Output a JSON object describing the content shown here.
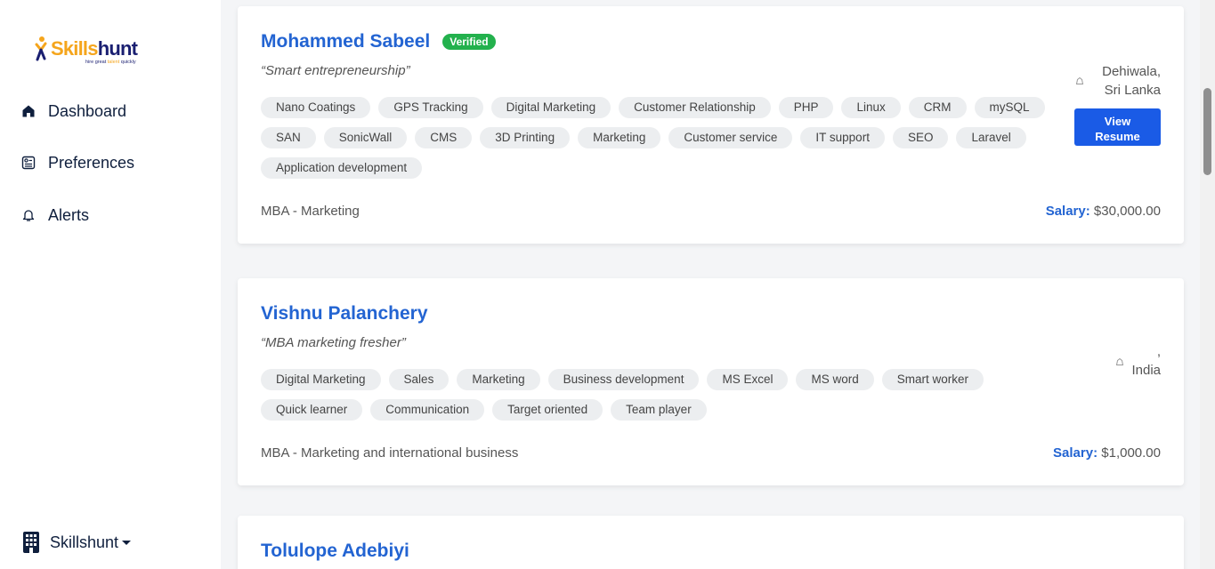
{
  "brand": {
    "name_a": "Skills",
    "name_b": "hunt",
    "tagline_a": "hire great ",
    "tagline_b": "talent",
    "tagline_c": " quickly"
  },
  "nav": [
    {
      "label": "Dashboard",
      "icon": "home-icon"
    },
    {
      "label": "Preferences",
      "icon": "preferences-icon"
    },
    {
      "label": "Alerts",
      "icon": "bell-icon"
    }
  ],
  "org": {
    "label": "Skillshunt",
    "icon": "building-icon"
  },
  "candidates": [
    {
      "name": "Mohammed Sabeel",
      "badge": "Verified",
      "tagline": "“Smart entrepreneurship”",
      "skills": [
        "Nano Coatings",
        "GPS Tracking",
        "Digital Marketing",
        "Customer Relationship",
        "PHP",
        "Linux",
        "CRM",
        "mySQL",
        "SAN",
        "SonicWall",
        "CMS",
        "3D Printing",
        "Marketing",
        "Customer service",
        "IT support",
        "SEO",
        "Laravel",
        "Application development"
      ],
      "degree": "MBA - Marketing",
      "location_line1": "Dehiwala,",
      "location_line2": "Sri Lanka",
      "button_line1": "View",
      "button_line2": "Resume",
      "salary_label": "Salary:",
      "salary_value": "$30,000.00"
    },
    {
      "name": "Vishnu Palanchery",
      "tagline": "“MBA marketing fresher”",
      "skills": [
        "Digital Marketing",
        "Sales",
        "Marketing",
        "Business development",
        "MS Excel",
        "MS word",
        "Smart worker",
        "Quick learner",
        "Communication",
        "Target oriented",
        "Team player"
      ],
      "degree": "MBA - Marketing and international business",
      "location_line1": ",",
      "location_line2": "India",
      "salary_label": "Salary:",
      "salary_value": "$1,000.00"
    },
    {
      "name": "Tolulope Adebiyi"
    }
  ],
  "colors": {
    "accent": "#2364d2",
    "button": "#1a5be6",
    "verified": "#23b14d",
    "brand_orange": "#f5a51c",
    "brand_navy": "#1a1f71"
  }
}
